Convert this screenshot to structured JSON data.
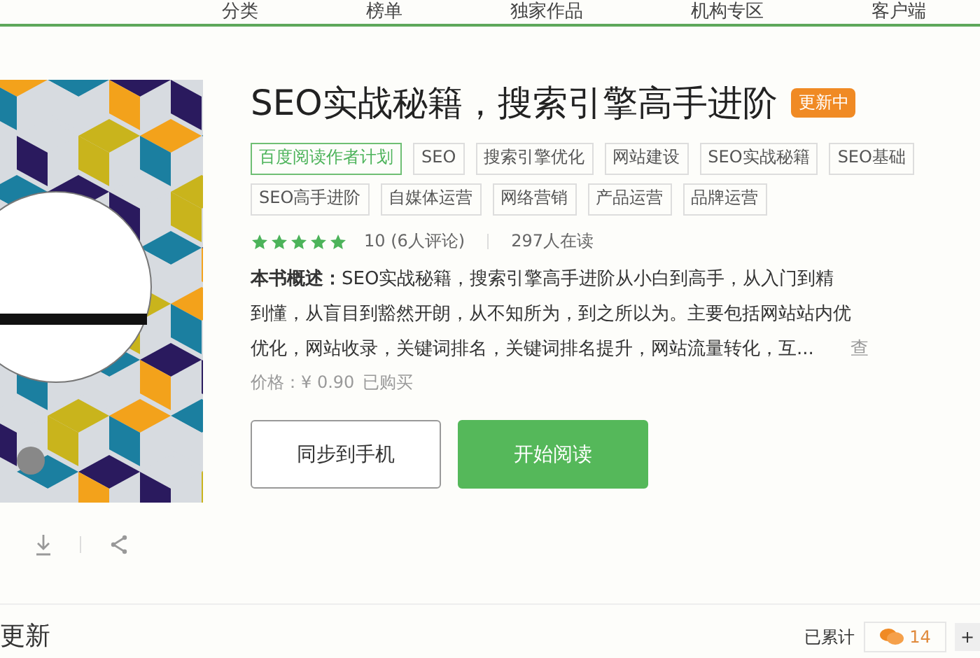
{
  "nav": {
    "items": [
      {
        "label": "分类"
      },
      {
        "label": "榜单"
      },
      {
        "label": "独家作品"
      },
      {
        "label": "机构专区"
      },
      {
        "label": "客户端"
      }
    ]
  },
  "book": {
    "title": "SEO实战秘籍，搜索引擎高手进阶",
    "badge": "更新中",
    "tags": [
      {
        "label": "百度阅读作者计划",
        "kind": "program"
      },
      {
        "label": "SEO",
        "kind": "tag"
      },
      {
        "label": "搜索引擎优化",
        "kind": "tag"
      },
      {
        "label": "网站建设",
        "kind": "tag"
      },
      {
        "label": "SEO实战秘籍",
        "kind": "tag"
      },
      {
        "label": "SEO基础",
        "kind": "tag"
      },
      {
        "label": "SEO高手进阶",
        "kind": "tag"
      },
      {
        "label": "自媒体运营",
        "kind": "tag"
      },
      {
        "label": "网络营销",
        "kind": "tag"
      },
      {
        "label": "产品运营",
        "kind": "tag"
      },
      {
        "label": "品牌运营",
        "kind": "tag"
      }
    ],
    "stars": 5,
    "score": "10 (6人评论)",
    "readers": "297人在读",
    "summary_label": "本书概述：",
    "summary_lines": [
      "SEO实战秘籍，搜索引擎高手进阶从小白到高手，从入门到精",
      "到懂，从盲目到豁然开朗，从不知所为，到之所以为。主要包括网站站内优",
      "优化，网站收录，关键词排名，关键词排名提升，网站流量转化，互..."
    ],
    "more_link": "查",
    "price": "价格：¥ 0.90",
    "purchased": "已购买",
    "buttons": [
      "同步到手机",
      "开始阅读"
    ]
  },
  "section": {
    "title": "更新",
    "total_label": "已累计",
    "comments": "14",
    "add": "+"
  }
}
